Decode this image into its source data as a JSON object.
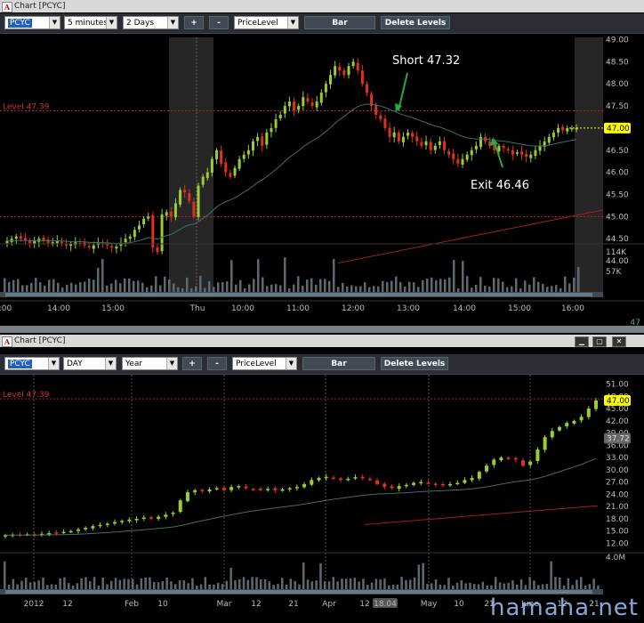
{
  "top_window": {
    "title": "Chart [PCYC]",
    "toolbar": {
      "symbol": "PCYC",
      "interval": "5 minutes",
      "range": "2 Days",
      "zoom_in_label": "+",
      "zoom_out_label": "-",
      "overlay": "PriceLevel",
      "chart_type_label": "Bar",
      "delete_levels_label": "Delete Levels"
    },
    "level_label": "Level 47.39",
    "price_badge": "47.00",
    "volume_max_label": "114K",
    "volume_mid_label": "57K",
    "scroll_value": "47",
    "annotations": {
      "short": "Short 47.32",
      "exit": "Exit 46.46"
    },
    "price_ticks": [
      "49.00",
      "48.50",
      "48.00",
      "47.50",
      "47.00",
      "46.50",
      "46.00",
      "45.50",
      "45.00",
      "44.50",
      "44.00"
    ],
    "time_ticks": [
      ":00",
      "14:00",
      "15:00",
      "Thu",
      "10:00",
      "11:00",
      "12:00",
      "13:00",
      "14:00",
      "15:00",
      "16:00"
    ]
  },
  "bottom_window": {
    "title": "Chart [PCYC]",
    "toolbar": {
      "symbol": "PCYC",
      "interval": "DAY",
      "range": "Year",
      "zoom_in_label": "+",
      "zoom_out_label": "-",
      "overlay": "PriceLevel",
      "chart_type_label": "Bar",
      "delete_levels_label": "Delete Levels"
    },
    "level_label": "Level 47.39",
    "price_badge": "47.00",
    "secondary_badge": "37.72",
    "volume_max_label": "4.0M",
    "price_ticks": [
      "51.00",
      "48.00",
      "45.00",
      "42.00",
      "39.00",
      "36.00",
      "33.00",
      "30.00",
      "27.00",
      "24.00",
      "21.00",
      "18.00",
      "15.00",
      "12.00"
    ],
    "date_ticks": [
      "2012",
      "12",
      "Feb",
      "10",
      "Mar",
      "12",
      "21",
      "Apr",
      "12",
      "18.04",
      "May",
      "10",
      "21",
      "June",
      "12",
      "21"
    ]
  },
  "watermark": "hamaha.net",
  "colors": {
    "up_candle": "#9acd32",
    "down_candle": "#e0301e",
    "level_line": "#c0202a",
    "ma_fast": "#3f6f6a",
    "ma_slow": "#a02020",
    "badge": "#ffff00",
    "annotation_arrow": "#22aa44"
  },
  "chart_data": [
    {
      "type": "candlestick",
      "title": "",
      "symbol": "PCYC",
      "interval": "5 minutes",
      "ylim": [
        43.7,
        49.05
      ],
      "horizontal_levels": [
        47.39,
        45.0
      ],
      "annotations": [
        {
          "text": "Short 47.32",
          "price": 47.32
        },
        {
          "text": "Exit 46.46",
          "price": 46.46
        }
      ],
      "close_path": [
        44.45,
        44.5,
        44.55,
        44.5,
        44.45,
        44.4,
        44.45,
        44.5,
        44.45,
        44.4,
        44.42,
        44.45,
        44.4,
        44.35,
        44.38,
        44.42,
        44.4,
        44.35,
        44.3,
        44.35,
        44.4,
        44.38,
        44.35,
        44.3,
        44.32,
        44.4,
        44.5,
        44.55,
        44.7,
        44.8,
        44.95,
        45.0,
        44.3,
        44.2,
        45.05,
        45.1,
        45.0,
        45.3,
        45.6,
        45.55,
        45.35,
        45.0,
        45.7,
        45.9,
        46.0,
        46.3,
        46.5,
        46.2,
        46.0,
        45.9,
        46.1,
        46.3,
        46.4,
        46.5,
        46.7,
        46.8,
        46.6,
        46.9,
        47.0,
        47.2,
        47.3,
        47.5,
        47.6,
        47.4,
        47.5,
        47.7,
        47.6,
        47.5,
        47.6,
        47.8,
        48.0,
        48.2,
        48.4,
        48.3,
        48.2,
        48.4,
        48.5,
        48.3,
        48.0,
        47.8,
        47.5,
        47.3,
        47.2,
        47.0,
        46.8,
        46.9,
        46.7,
        46.8,
        46.9,
        46.8,
        46.7,
        46.6,
        46.7,
        46.5,
        46.6,
        46.7,
        46.5,
        46.4,
        46.3,
        46.2,
        46.3,
        46.4,
        46.5,
        46.6,
        46.8,
        46.7,
        46.6,
        46.5,
        46.6,
        46.55,
        46.5,
        46.4,
        46.45,
        46.4,
        46.35,
        46.4,
        46.5,
        46.6,
        46.7,
        46.8,
        46.9,
        47.0,
        46.95,
        47.0,
        47.0,
        47.0
      ]
    },
    {
      "type": "candlestick",
      "title": "",
      "symbol": "PCYC",
      "interval": "DAY",
      "ylim": [
        11.0,
        52.0
      ],
      "horizontal_levels": [
        47.39
      ],
      "close_path": [
        14.0,
        14.1,
        14.0,
        14.2,
        14.1,
        14.3,
        14.5,
        14.6,
        14.8,
        15.0,
        15.4,
        15.8,
        16.2,
        16.5,
        16.8,
        17.2,
        17.5,
        17.8,
        18.0,
        18.3,
        18.1,
        18.5,
        19.0,
        19.5,
        22.5,
        24.5,
        25.0,
        24.8,
        25.2,
        25.5,
        25.0,
        25.8,
        26.0,
        25.5,
        25.2,
        25.0,
        25.3,
        25.0,
        25.2,
        25.5,
        25.8,
        26.5,
        27.5,
        28.0,
        28.3,
        28.0,
        27.5,
        27.8,
        28.2,
        28.0,
        27.5,
        26.5,
        25.8,
        25.5,
        26.0,
        26.3,
        26.8,
        27.0,
        26.8,
        26.5,
        26.3,
        26.5,
        26.8,
        27.5,
        28.0,
        29.5,
        31.0,
        32.5,
        33.0,
        32.8,
        32.5,
        31.0,
        32.0,
        35.0,
        38.0,
        39.5,
        40.5,
        41.5,
        42.0,
        43.0,
        45.0,
        47.0
      ]
    }
  ]
}
